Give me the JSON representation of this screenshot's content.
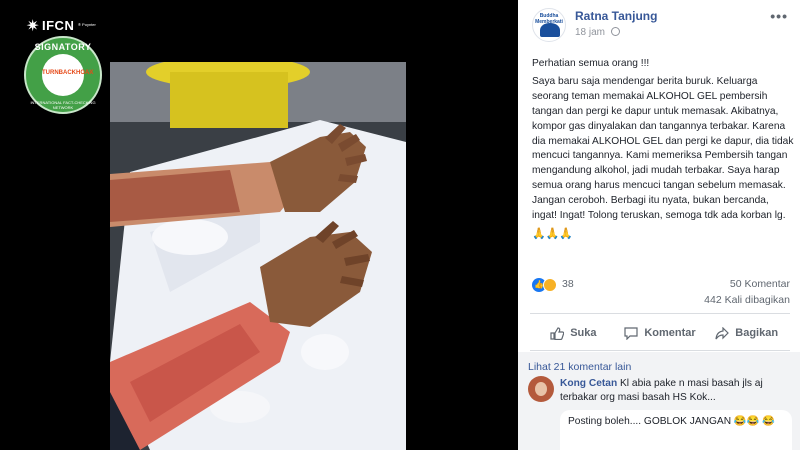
{
  "badge": {
    "org": "IFCN",
    "poynter": "® Poynter",
    "signatory": "SIGNATORY",
    "network": "INTERNATIONAL FACT-CHECKING NETWORK",
    "member": "TURNBACKHOAX"
  },
  "post": {
    "author": "Ratna Tanjung",
    "page_avatar_text": "Buddha Memberkati",
    "time": "18 jam",
    "more_label": "•••",
    "paragraphs": [
      "Perhatian semua orang !!!",
      "Saya baru saja mendengar berita buruk. Keluarga seorang teman memakai ALKOHOL GEL pembersih tangan dan pergi ke dapur untuk memasak. Akibatnya, kompor gas dinyalakan dan tangannya terbakar. Karena dia memakai ALKOHOL GEL dan pergi ke dapur, dia tidak mencuci tangannya. Kami memeriksa Pembersih tangan mengandung alkohol, jadi mudah terbakar. Saya harap semua orang harus mencuci tangan sebelum memasak. Jangan ceroboh. Berbagi itu nyata, bukan bercanda, ingat! Ingat! Tolong teruskan, semoga tdk ada korban lg."
    ],
    "emoji_line": "🙏🙏🙏",
    "reaction_count": "38",
    "comment_count": "50 Komentar",
    "share_count": "442 Kali dibagikan",
    "actions": {
      "like": "Suka",
      "comment": "Komentar",
      "share": "Bagikan"
    }
  },
  "comments": {
    "more_label": "Lihat 21 komentar lain",
    "first": {
      "name": "Kong Cetan",
      "text": "Kl abia pake n masi basah jls aj terbakar org masi basah HS Kok..."
    },
    "second": {
      "text": "Posting boleh.... GOBLOK JANGAN 😂😂 😂"
    }
  },
  "colors": {
    "link_blue": "#385898",
    "like_blue": "#1877f2",
    "badge_green": "#43a047"
  }
}
